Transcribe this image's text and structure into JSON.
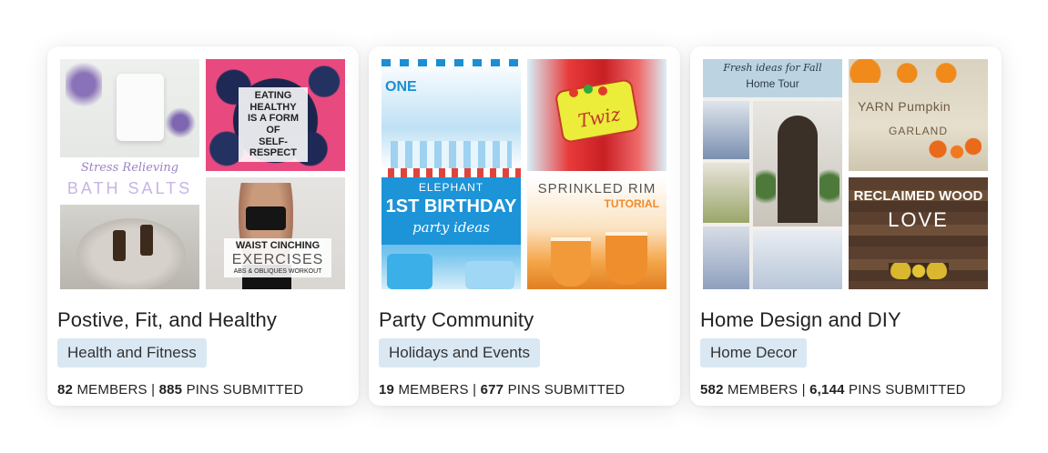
{
  "cards": [
    {
      "title": "Postive, Fit, and Healthy",
      "category": "Health and Fitness",
      "members_count": "82",
      "members_label": "MEMBERS",
      "separator": "|",
      "pins_count": "885",
      "pins_label": "PINS SUBMITTED",
      "images": {
        "big": {
          "line1": "Stress Relieving",
          "line2": "BATH SALTS"
        },
        "top": {
          "lines": [
            "EATING HEALTHY",
            "IS A FORM OF",
            "SELF-RESPECT"
          ]
        },
        "bottom": {
          "line1": "WAIST CINCHING",
          "line2": "EXERCISES",
          "line3": "ABS & OBLIQUES WORKOUT"
        }
      }
    },
    {
      "title": "Party Community",
      "category": "Holidays and Events",
      "members_count": "19",
      "members_label": "MEMBERS",
      "separator": "|",
      "pins_count": "677",
      "pins_label": "PINS SUBMITTED",
      "images": {
        "big": {
          "line0": "ONE",
          "line1": "ELEPHANT",
          "line2": "1ST BIRTHDAY",
          "line3": "party ideas"
        },
        "top": {
          "line1": "Twiz"
        },
        "bottom": {
          "line1": "SPRINKLED RIM",
          "line2": "TUTORIAL"
        }
      }
    },
    {
      "title": "Home Design and DIY",
      "category": "Home Decor",
      "members_count": "582",
      "members_label": "MEMBERS",
      "separator": "|",
      "pins_count": "6,144",
      "pins_label": "PINS SUBMITTED",
      "images": {
        "big": {
          "line1": "Fresh ideas for Fall",
          "line2": "Home Tour"
        },
        "top": {
          "line1": "YARN Pumpkin",
          "line2": "GARLAND"
        },
        "bottom": {
          "line1": "RECLAIMED WOOD",
          "line2": "LOVE"
        }
      }
    }
  ]
}
